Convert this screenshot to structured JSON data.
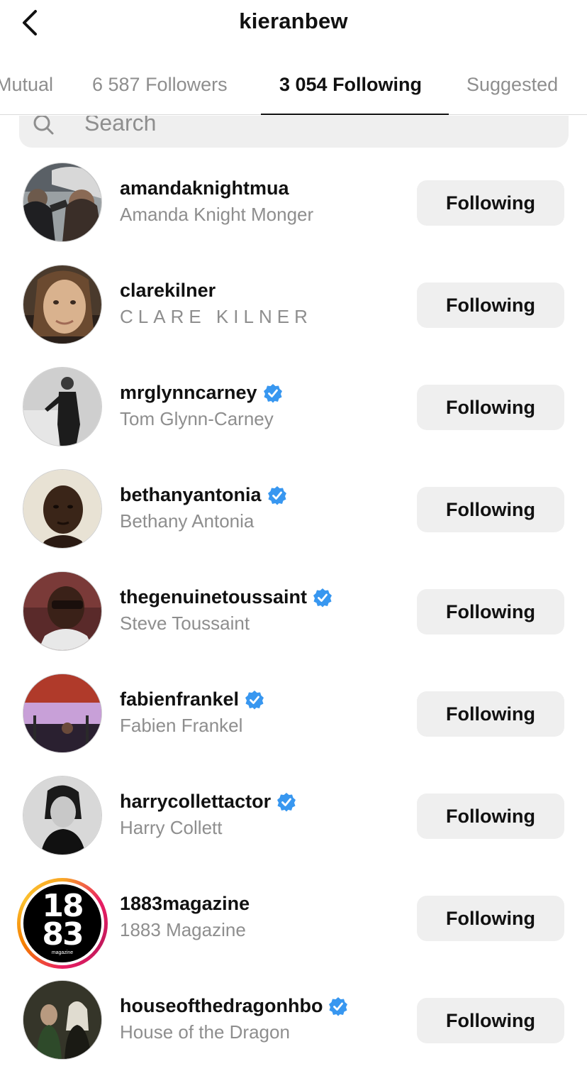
{
  "header": {
    "title": "kieranbew"
  },
  "tabs": [
    {
      "label": "Mutual"
    },
    {
      "label": "6 587 Followers"
    },
    {
      "label": "3 054 Following"
    },
    {
      "label": "Suggested"
    }
  ],
  "active_tab": "3 054 Following",
  "search": {
    "placeholder": "Search"
  },
  "accounts": [
    {
      "username": "amandaknightmua",
      "full_name": "Amanda Knight Monger",
      "verified": false,
      "button": "Following"
    },
    {
      "username": "clarekilner",
      "full_name": "CLARE KILNER",
      "verified": false,
      "button": "Following"
    },
    {
      "username": "mrglynncarney",
      "full_name": "Tom Glynn-Carney",
      "verified": true,
      "button": "Following"
    },
    {
      "username": "bethanyantonia",
      "full_name": "Bethany Antonia",
      "verified": true,
      "button": "Following"
    },
    {
      "username": "thegenuinetoussaint",
      "full_name": "Steve Toussaint",
      "verified": true,
      "button": "Following"
    },
    {
      "username": "fabienfrankel",
      "full_name": "Fabien Frankel",
      "verified": true,
      "button": "Following"
    },
    {
      "username": "harrycollettactor",
      "full_name": "Harry Collett",
      "verified": true,
      "button": "Following"
    },
    {
      "username": "1883magazine",
      "full_name": "1883 Magazine",
      "verified": false,
      "button": "Following",
      "avatar_lines": [
        "18",
        "83",
        "magazine"
      ]
    },
    {
      "username": "houseofthedragonhbo",
      "full_name": "House of the Dragon",
      "verified": true,
      "button": "Following"
    }
  ],
  "colors": {
    "verified_badge": "#3897f0",
    "button_bg": "#efefef",
    "secondary_text": "#8e8e8e"
  }
}
